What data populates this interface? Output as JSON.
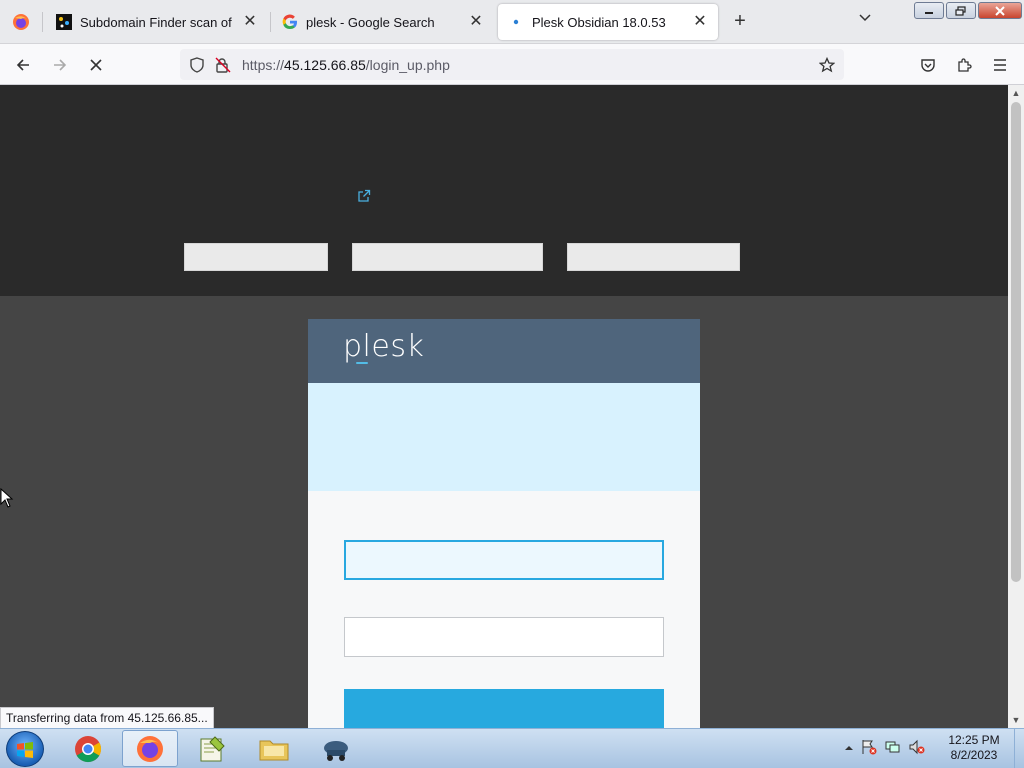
{
  "browser": {
    "tabs": [
      {
        "title": "Subdomain Finder scan of pack",
        "favicon": "subdomain-finder-icon",
        "active": false
      },
      {
        "title": "plesk - Google Search",
        "favicon": "google-icon",
        "active": false
      },
      {
        "title": "Plesk Obsidian 18.0.53",
        "favicon": "loading-dot-icon",
        "active": true
      }
    ],
    "close_glyph": "✕",
    "new_tab_glyph": "+",
    "url_prefix": "https://",
    "url_host": "45.125.66.85",
    "url_path": "/login_up.php",
    "status_text": "Transferring data from 45.125.66.85..."
  },
  "page": {
    "logo_text": "plesk",
    "colors": {
      "top_band": "#2a2a2a",
      "page_bg": "#454545",
      "card_header": "#4f657c",
      "banner": "#d8f2fe",
      "accent": "#27a9df"
    }
  },
  "taskbar": {
    "apps": [
      "chrome-icon",
      "firefox-icon",
      "notepad-plus-plus-icon",
      "file-explorer-icon",
      "network-app-icon"
    ],
    "time": "12:25 PM",
    "date": "8/2/2023"
  }
}
